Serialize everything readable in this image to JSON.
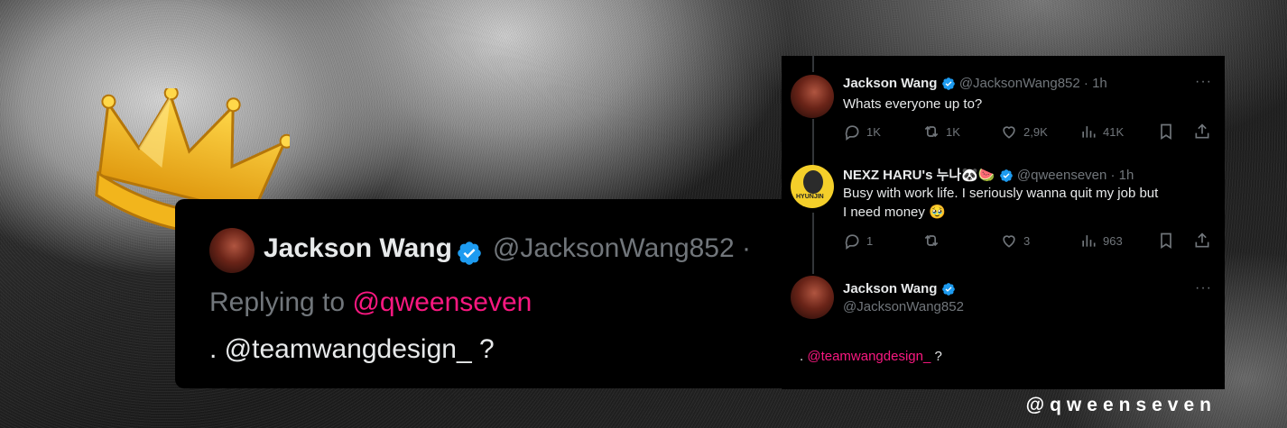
{
  "big_tweet": {
    "name": "Jackson Wang",
    "handle": "@JacksonWang852 ·",
    "replying_prefix": "Replying to ",
    "replying_handle": "@qweenseven",
    "text_prefix": ". ",
    "text_mention": "@teamwangdesign_",
    "text_suffix": " ?"
  },
  "thread": {
    "tweet1": {
      "name": "Jackson Wang",
      "handle": "@JacksonWang852 · 1h",
      "text": "Whats everyone up to?",
      "replies": "1K",
      "reposts": "1K",
      "likes": "2,9K",
      "views": "41K"
    },
    "tweet2": {
      "name": "NEXZ HARU's 누나🐼🍉",
      "handle": "@qweenseven · 1h",
      "text_line1": "Busy with work life. I seriously wanna quit my job but",
      "text_line2": "I need money 🥹",
      "replies": "1",
      "reposts": "",
      "likes": "3",
      "views": "963",
      "avatar_label": "HYUNJIN"
    },
    "tweet3": {
      "name": "Jackson Wang",
      "handle": "@JacksonWang852",
      "text_prefix": ". ",
      "text_mention": "@teamwangdesign_",
      "text_suffix": " ?"
    },
    "more_label": "···"
  },
  "watermark": "@qweenseven",
  "colors": {
    "verified": "#1d9bf0",
    "mention": "#f91880",
    "muted": "#71767b",
    "text": "#e7e9ea",
    "panel": "#000000"
  },
  "icons": [
    "crown-icon",
    "verified-icon",
    "reply-icon",
    "repost-icon",
    "like-icon",
    "views-icon",
    "bookmark-icon",
    "share-icon",
    "more-icon"
  ]
}
